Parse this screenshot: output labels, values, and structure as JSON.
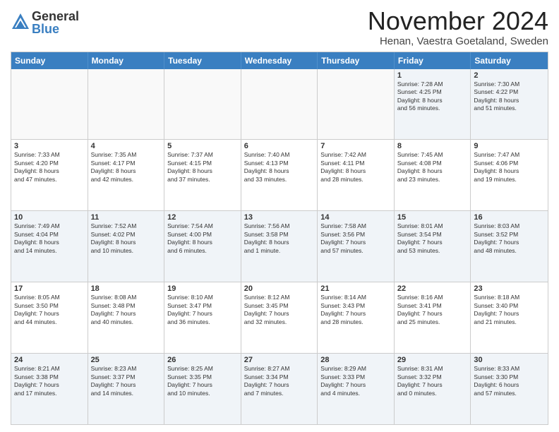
{
  "logo": {
    "general": "General",
    "blue": "Blue"
  },
  "title": "November 2024",
  "subtitle": "Henan, Vaestra Goetaland, Sweden",
  "header_days": [
    "Sunday",
    "Monday",
    "Tuesday",
    "Wednesday",
    "Thursday",
    "Friday",
    "Saturday"
  ],
  "weeks": [
    [
      {
        "day": "",
        "info": ""
      },
      {
        "day": "",
        "info": ""
      },
      {
        "day": "",
        "info": ""
      },
      {
        "day": "",
        "info": ""
      },
      {
        "day": "",
        "info": ""
      },
      {
        "day": "1",
        "info": "Sunrise: 7:28 AM\nSunset: 4:25 PM\nDaylight: 8 hours\nand 56 minutes."
      },
      {
        "day": "2",
        "info": "Sunrise: 7:30 AM\nSunset: 4:22 PM\nDaylight: 8 hours\nand 51 minutes."
      }
    ],
    [
      {
        "day": "3",
        "info": "Sunrise: 7:33 AM\nSunset: 4:20 PM\nDaylight: 8 hours\nand 47 minutes."
      },
      {
        "day": "4",
        "info": "Sunrise: 7:35 AM\nSunset: 4:17 PM\nDaylight: 8 hours\nand 42 minutes."
      },
      {
        "day": "5",
        "info": "Sunrise: 7:37 AM\nSunset: 4:15 PM\nDaylight: 8 hours\nand 37 minutes."
      },
      {
        "day": "6",
        "info": "Sunrise: 7:40 AM\nSunset: 4:13 PM\nDaylight: 8 hours\nand 33 minutes."
      },
      {
        "day": "7",
        "info": "Sunrise: 7:42 AM\nSunset: 4:11 PM\nDaylight: 8 hours\nand 28 minutes."
      },
      {
        "day": "8",
        "info": "Sunrise: 7:45 AM\nSunset: 4:08 PM\nDaylight: 8 hours\nand 23 minutes."
      },
      {
        "day": "9",
        "info": "Sunrise: 7:47 AM\nSunset: 4:06 PM\nDaylight: 8 hours\nand 19 minutes."
      }
    ],
    [
      {
        "day": "10",
        "info": "Sunrise: 7:49 AM\nSunset: 4:04 PM\nDaylight: 8 hours\nand 14 minutes."
      },
      {
        "day": "11",
        "info": "Sunrise: 7:52 AM\nSunset: 4:02 PM\nDaylight: 8 hours\nand 10 minutes."
      },
      {
        "day": "12",
        "info": "Sunrise: 7:54 AM\nSunset: 4:00 PM\nDaylight: 8 hours\nand 6 minutes."
      },
      {
        "day": "13",
        "info": "Sunrise: 7:56 AM\nSunset: 3:58 PM\nDaylight: 8 hours\nand 1 minute."
      },
      {
        "day": "14",
        "info": "Sunrise: 7:58 AM\nSunset: 3:56 PM\nDaylight: 7 hours\nand 57 minutes."
      },
      {
        "day": "15",
        "info": "Sunrise: 8:01 AM\nSunset: 3:54 PM\nDaylight: 7 hours\nand 53 minutes."
      },
      {
        "day": "16",
        "info": "Sunrise: 8:03 AM\nSunset: 3:52 PM\nDaylight: 7 hours\nand 48 minutes."
      }
    ],
    [
      {
        "day": "17",
        "info": "Sunrise: 8:05 AM\nSunset: 3:50 PM\nDaylight: 7 hours\nand 44 minutes."
      },
      {
        "day": "18",
        "info": "Sunrise: 8:08 AM\nSunset: 3:48 PM\nDaylight: 7 hours\nand 40 minutes."
      },
      {
        "day": "19",
        "info": "Sunrise: 8:10 AM\nSunset: 3:47 PM\nDaylight: 7 hours\nand 36 minutes."
      },
      {
        "day": "20",
        "info": "Sunrise: 8:12 AM\nSunset: 3:45 PM\nDaylight: 7 hours\nand 32 minutes."
      },
      {
        "day": "21",
        "info": "Sunrise: 8:14 AM\nSunset: 3:43 PM\nDaylight: 7 hours\nand 28 minutes."
      },
      {
        "day": "22",
        "info": "Sunrise: 8:16 AM\nSunset: 3:41 PM\nDaylight: 7 hours\nand 25 minutes."
      },
      {
        "day": "23",
        "info": "Sunrise: 8:18 AM\nSunset: 3:40 PM\nDaylight: 7 hours\nand 21 minutes."
      }
    ],
    [
      {
        "day": "24",
        "info": "Sunrise: 8:21 AM\nSunset: 3:38 PM\nDaylight: 7 hours\nand 17 minutes."
      },
      {
        "day": "25",
        "info": "Sunrise: 8:23 AM\nSunset: 3:37 PM\nDaylight: 7 hours\nand 14 minutes."
      },
      {
        "day": "26",
        "info": "Sunrise: 8:25 AM\nSunset: 3:35 PM\nDaylight: 7 hours\nand 10 minutes."
      },
      {
        "day": "27",
        "info": "Sunrise: 8:27 AM\nSunset: 3:34 PM\nDaylight: 7 hours\nand 7 minutes."
      },
      {
        "day": "28",
        "info": "Sunrise: 8:29 AM\nSunset: 3:33 PM\nDaylight: 7 hours\nand 4 minutes."
      },
      {
        "day": "29",
        "info": "Sunrise: 8:31 AM\nSunset: 3:32 PM\nDaylight: 7 hours\nand 0 minutes."
      },
      {
        "day": "30",
        "info": "Sunrise: 8:33 AM\nSunset: 3:30 PM\nDaylight: 6 hours\nand 57 minutes."
      }
    ]
  ]
}
